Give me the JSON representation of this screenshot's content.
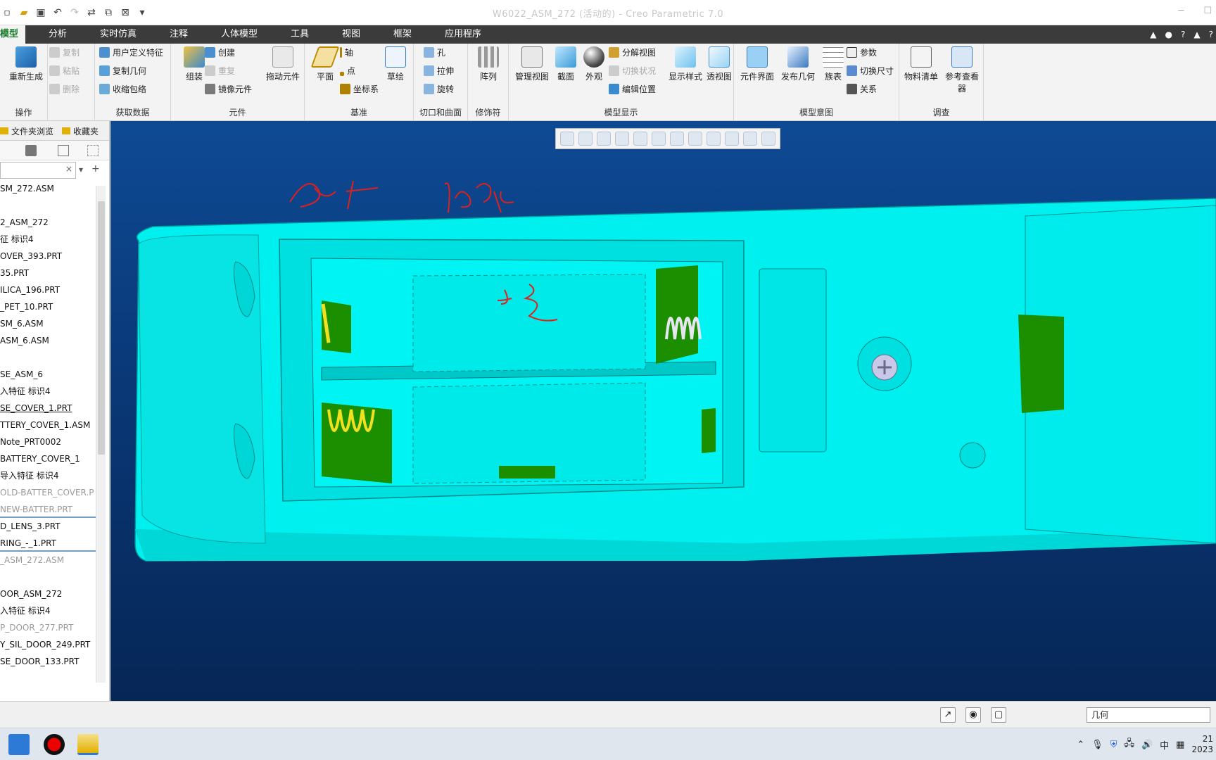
{
  "window": {
    "title": "W6022_ASM_272 (活动的) - Creo Parametric 7.0"
  },
  "tabs": [
    "模型",
    "分析",
    "实时仿真",
    "注释",
    "人体模型",
    "工具",
    "视图",
    "框架",
    "应用程序"
  ],
  "ribbon": {
    "ops": {
      "regen": "重新生成",
      "copy": "复制",
      "paste": "粘贴",
      "delete": "删除",
      "label": "操作"
    },
    "data": {
      "udf": "用户定义特征",
      "copygeom": "复制几何",
      "shrinkwrap": "收缩包络",
      "label": "获取数据"
    },
    "comp": {
      "assemble": "组装",
      "create": "创建",
      "repeat": "重复",
      "mirror": "镜像元件",
      "drag": "拖动元件",
      "label": "元件"
    },
    "datum": {
      "plane": "平面",
      "axis": "轴",
      "point": "点",
      "csys": "坐标系",
      "sketch": "草绘",
      "label": "基准"
    },
    "cut": {
      "hole": "孔",
      "extrude": "拉伸",
      "revolve": "旋转",
      "label": "切口和曲面"
    },
    "mod": {
      "pattern": "阵列",
      "label": "修饰符"
    },
    "display": {
      "manage": "管理视图",
      "section": "截面",
      "appearance": "外观",
      "explode": "分解视图",
      "toggle": "切换状况",
      "editpos": "编辑位置",
      "style": "显示样式",
      "persp": "透视图",
      "label": "模型显示"
    },
    "intent": {
      "iface": "元件界面",
      "publish": "发布几何",
      "family": "族表",
      "params": "参数",
      "switchdim": "切换尺寸",
      "relations": "关系",
      "label": "模型意图"
    },
    "investigate": {
      "bom": "物料清单",
      "refview": "参考查看器",
      "label": "调查"
    }
  },
  "leftpanel": {
    "tab1": "文件夹浏览",
    "tab2": "收藏夹",
    "tree": [
      {
        "t": "SM_272.ASM",
        "s": ""
      },
      {
        "t": "",
        "s": ""
      },
      {
        "t": "2_ASM_272",
        "s": ""
      },
      {
        "t": "征 标识4",
        "s": ""
      },
      {
        "t": "OVER_393.PRT",
        "s": ""
      },
      {
        "t": "35.PRT",
        "s": ""
      },
      {
        "t": "ILICA_196.PRT",
        "s": ""
      },
      {
        "t": "_PET_10.PRT",
        "s": ""
      },
      {
        "t": "SM_6.ASM",
        "s": ""
      },
      {
        "t": "ASM_6.ASM",
        "s": ""
      },
      {
        "t": "",
        "s": ""
      },
      {
        "t": "SE_ASM_6",
        "s": ""
      },
      {
        "t": "入特征 标识4",
        "s": ""
      },
      {
        "t": "SE_COVER_1.PRT",
        "s": "link"
      },
      {
        "t": "TTERY_COVER_1.ASM",
        "s": ""
      },
      {
        "t": " Note_PRT0002",
        "s": ""
      },
      {
        "t": " BATTERY_COVER_1",
        "s": ""
      },
      {
        "t": " 导入特征 标识4",
        "s": ""
      },
      {
        "t": " OLD-BATTER_COVER.P",
        "s": "grey"
      },
      {
        "t": " NEW-BATTER.PRT",
        "s": "grey sep"
      },
      {
        "t": "D_LENS_3.PRT",
        "s": ""
      },
      {
        "t": "RING_-_1.PRT",
        "s": "sep"
      },
      {
        "t": "_ASM_272.ASM",
        "s": "grey"
      },
      {
        "t": "",
        "s": ""
      },
      {
        "t": "OOR_ASM_272",
        "s": ""
      },
      {
        "t": "入特征 标识4",
        "s": ""
      },
      {
        "t": "P_DOOR_277.PRT",
        "s": "grey"
      },
      {
        "t": "Y_SIL_DOOR_249.PRT",
        "s": ""
      },
      {
        "t": "SE_DOOR_133.PRT",
        "s": ""
      }
    ]
  },
  "status": {
    "filter": "几何"
  },
  "taskbar": {
    "ime": "中",
    "time": "21",
    "date": "2023"
  },
  "colors": {
    "model": "#00f0f0",
    "green": "#1c8f00",
    "bg_top": "#0e4a94",
    "bg_bottom": "#062656",
    "annotation": "#e0201a"
  }
}
